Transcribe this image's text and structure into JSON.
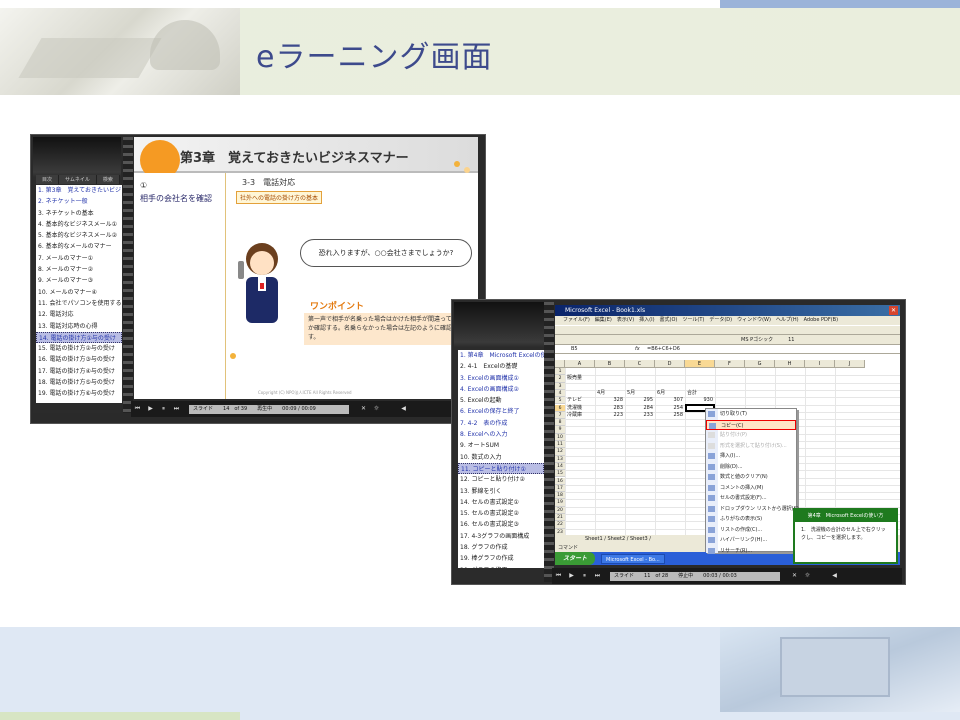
{
  "page": {
    "title": "eラーニング画面"
  },
  "player1": {
    "tabs": [
      "目次",
      "サムネイル",
      "検索"
    ],
    "toc": [
      {
        "label": "1. 第3章　覚えておきたいビジ",
        "style": "blue"
      },
      {
        "label": "2. ネチケット一般",
        "style": "blue"
      },
      {
        "label": "3. ネチケットの基本",
        "style": ""
      },
      {
        "label": "4. 基本的なビジネスメール①",
        "style": ""
      },
      {
        "label": "5. 基本的なビジネスメール②",
        "style": ""
      },
      {
        "label": "6. 基本的なメールのマナー",
        "style": ""
      },
      {
        "label": "7. メールのマナー①",
        "style": ""
      },
      {
        "label": "8. メールのマナー②",
        "style": ""
      },
      {
        "label": "9. メールのマナー③",
        "style": ""
      },
      {
        "label": "10. メールのマナー④",
        "style": ""
      },
      {
        "label": "11. 会社でパソコンを使用する",
        "style": ""
      },
      {
        "label": "12. 電話対応",
        "style": ""
      },
      {
        "label": "13. 電話対応時の心得",
        "style": ""
      },
      {
        "label": "14. 電話の掛け方①与の受け",
        "style": "sel"
      },
      {
        "label": "15. 電話の掛け方②与の受け",
        "style": ""
      },
      {
        "label": "16. 電話の掛け方③与の受け",
        "style": ""
      },
      {
        "label": "17. 電話の掛け方④与の受け",
        "style": ""
      },
      {
        "label": "18. 電話の掛け方⑤与の受け",
        "style": ""
      },
      {
        "label": "19. 電話の掛け方⑥与の受け",
        "style": ""
      }
    ],
    "slide": {
      "chapter": "第3章　覚えておきたいビジネスマナー",
      "number": "①",
      "subtitle": "相手の会社名を確認",
      "section": "3-3　電話対応",
      "tag": "社外への電話の掛け方の基本",
      "bubble": "恐れ入りますが、○○会社さまでしょうか?",
      "onepoint": "ワンポイント",
      "note": "第一声で相手が名乗った場合はかけた相手が間違っていないか確認する。名乗らなかった場合は左記のように確認します。",
      "copyright": "Copyright (C)  NPO法人ICTE All Rights Reserved"
    },
    "control": {
      "slide_label": "スライド",
      "slide_pos": "14　of 39",
      "status": "再生中",
      "time": "00:09 / 00:09"
    }
  },
  "player2": {
    "toc": [
      {
        "label": "1. 第4章　Microsoft Excelの使",
        "style": "blue"
      },
      {
        "label": "2. 4-1　Excelの基礎",
        "style": ""
      },
      {
        "label": "3. Excelの画面構成①",
        "style": "blue"
      },
      {
        "label": "4. Excelの画面構成②",
        "style": "blue"
      },
      {
        "label": "5. Excelの起動",
        "style": ""
      },
      {
        "label": "6. Excelの保存と終了",
        "style": "blue"
      },
      {
        "label": "7. 4-2　表の作成",
        "style": "blue"
      },
      {
        "label": "8. Excelへの入力",
        "style": "blue"
      },
      {
        "label": "9. オートSUM",
        "style": ""
      },
      {
        "label": "10. 数式の入力",
        "style": ""
      },
      {
        "label": "11. コピーと貼り付け①",
        "style": "sel"
      },
      {
        "label": "12. コピーと貼り付け②",
        "style": ""
      },
      {
        "label": "13. 罫線を引く",
        "style": ""
      },
      {
        "label": "14. セルの書式設定①",
        "style": ""
      },
      {
        "label": "15. セルの書式設定②",
        "style": ""
      },
      {
        "label": "16. セルの書式設定③",
        "style": ""
      },
      {
        "label": "17. 4-3グラフの画面構成",
        "style": ""
      },
      {
        "label": "18. グラフの作成",
        "style": ""
      },
      {
        "label": "19. 棒グラフの作成",
        "style": ""
      },
      {
        "label": "20. グラフの修正",
        "style": ""
      }
    ],
    "excel": {
      "title": "Microsoft Excel - Book1.xls",
      "menu": "ファイル(F)　編集(E)　表示(V)　挿入(I)　書式(O)　ツール(T)　データ(D)　ウィンドウ(W)　ヘルプ(H)　Adobe PDF(B)",
      "font": "MS Pゴシック　　　11",
      "namebox": "B5",
      "formula": "=B6+C6+D6",
      "columns": [
        "A",
        "B",
        "C",
        "D",
        "E",
        "F",
        "G",
        "H",
        "I",
        "J"
      ],
      "rows": [
        "1",
        "2",
        "3",
        "4",
        "5",
        "6",
        "7",
        "8",
        "9",
        "10",
        "11",
        "12",
        "13",
        "14",
        "15",
        "16",
        "17",
        "18",
        "19",
        "20",
        "21",
        "22",
        "23",
        "24",
        "25"
      ],
      "cells": {
        "a2": "販売量",
        "b4": "4月",
        "c4": "5月",
        "d4": "6月",
        "e4": "合計",
        "a5": "テレビ",
        "b5": "328",
        "c5": "295",
        "d5": "307",
        "e5": "930",
        "a6": "洗濯機",
        "b6": "283",
        "c6": "284",
        "d6": "254",
        "a7": "冷蔵庫",
        "b7": "223",
        "c7": "233",
        "d7": "258"
      },
      "sheets": "Sheet1 / Sheet2 / Sheet3 /",
      "status": "コマンド",
      "start": "スタート",
      "taskbar_item": "Microsoft Excel - Bo..."
    },
    "context_menu": [
      {
        "label": "切り取り(T)",
        "state": ""
      },
      {
        "label": "コピー(C)",
        "state": "hi"
      },
      {
        "label": "貼り付け(P)",
        "state": "dis"
      },
      {
        "label": "形式を選択して貼り付け(S)...",
        "state": "dis"
      },
      {
        "label": "挿入(I)...",
        "state": ""
      },
      {
        "label": "削除(D)...",
        "state": ""
      },
      {
        "label": "数式と値のクリア(N)",
        "state": ""
      },
      {
        "label": "コメントの挿入(M)",
        "state": ""
      },
      {
        "label": "セルの書式設定(F)...",
        "state": ""
      },
      {
        "label": "ドロップダウン リストから選択(K)...",
        "state": ""
      },
      {
        "label": "ふりがなの表示(S)",
        "state": ""
      },
      {
        "label": "リストの作成(C)...",
        "state": ""
      },
      {
        "label": "ハイパーリンク(H)...",
        "state": ""
      },
      {
        "label": "リサーチ(R)...",
        "state": ""
      }
    ],
    "help": {
      "title": "第4章　Microsoft Excelの使い方",
      "text": "1.　洗濯機の合計のセル上で右クリックし、コピーを選択します。"
    },
    "control": {
      "slide_label": "スライド",
      "slide_pos": "11　of 28",
      "status": "停止中",
      "time": "00:03 / 00:03"
    }
  }
}
